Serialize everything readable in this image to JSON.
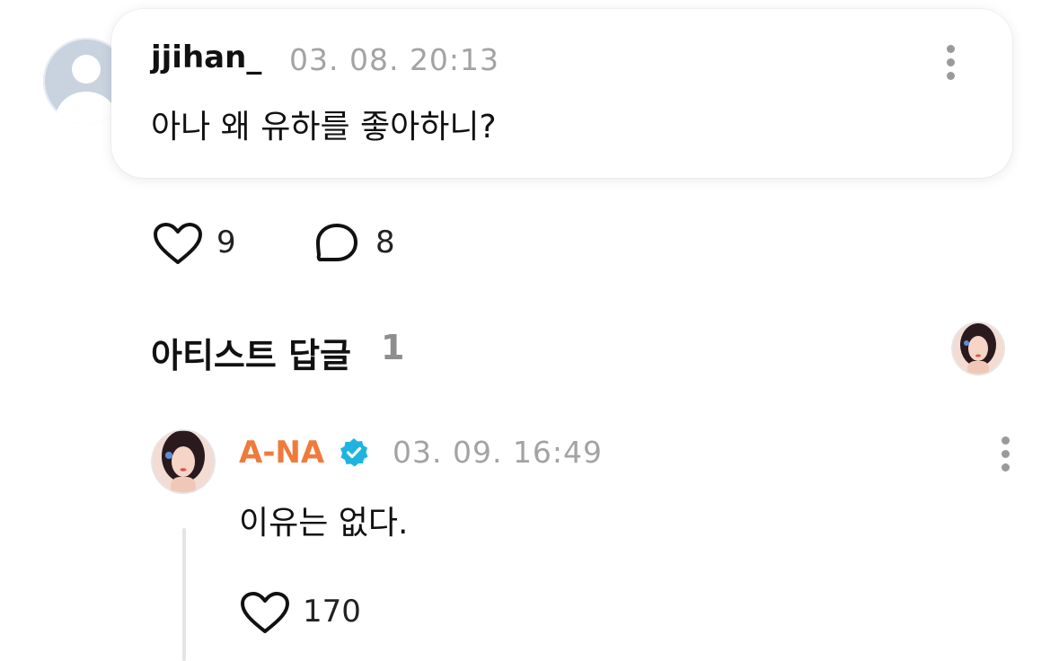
{
  "comment": {
    "username": "jjihan_",
    "timestamp": "03. 08. 20:13",
    "text": "아나 왜 유하를 좋아하니?",
    "like_count": "9",
    "reply_count": "8",
    "avatar_icon": "default-user-avatar",
    "more_icon": "more-vertical-icon"
  },
  "artist_replies": {
    "title": "아티스트 답글",
    "count": "1"
  },
  "reply": {
    "username": "A-NA",
    "verified_icon": "verified-badge-icon",
    "timestamp": "03. 09. 16:49",
    "text": "이유는 없다.",
    "like_count": "170",
    "more_icon": "more-vertical-icon"
  },
  "colors": {
    "artist_name": "#f07a3c",
    "verified_badge": "#1fb3e0",
    "muted_text": "#a3a3a3",
    "count_muted": "#8e8e8e"
  }
}
